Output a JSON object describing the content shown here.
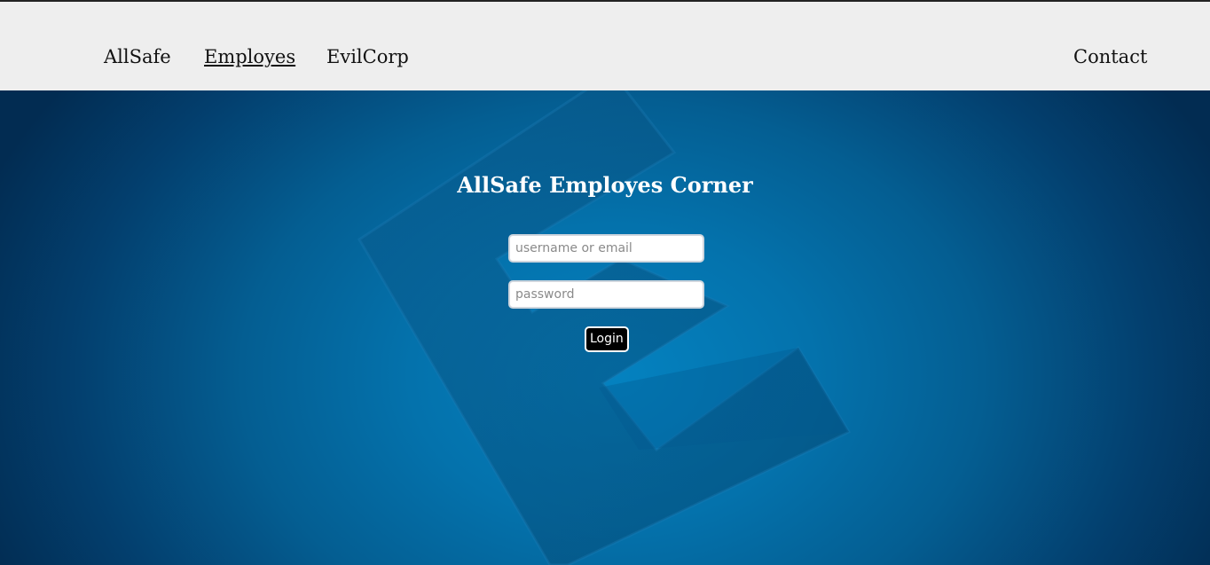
{
  "nav": {
    "items": [
      {
        "label": "AllSafe"
      },
      {
        "label": "Employes",
        "active": true
      },
      {
        "label": "EvilCorp"
      }
    ],
    "contact_label": "Contact"
  },
  "login": {
    "title": "AllSafe Employes Corner",
    "username_placeholder": "username or email",
    "password_placeholder": "password",
    "button_label": "Login"
  },
  "background": {
    "logo_icon": "e-corp-logo-icon",
    "accent_color": "#0482c0",
    "navbar_color": "#eeeeee"
  }
}
